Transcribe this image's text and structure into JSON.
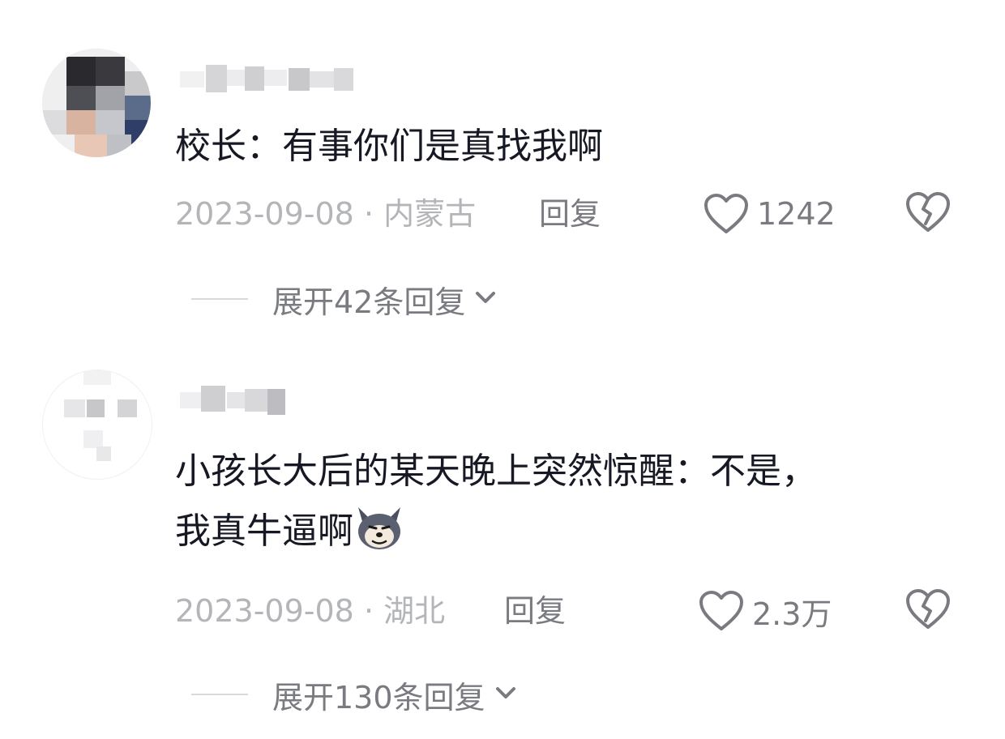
{
  "comments": [
    {
      "text": "校长：有事你们是真找我啊",
      "date": "2023-09-08",
      "separator": "·",
      "location": "内蒙古",
      "reply_label": "回复",
      "likes": "1242",
      "expand_label": "展开42条回复",
      "avatar_icon": "pixelated-avatar",
      "like_icon": "heart-outline-icon",
      "dislike_icon": "broken-heart-icon"
    },
    {
      "text_line1": "小孩长大后的某天晚上突然惊醒：不是，",
      "text_line2": "我真牛逼啊",
      "emoji_icon": "wolf-emoji-icon",
      "date": "2023-09-08",
      "separator": "·",
      "location": "湖北",
      "reply_label": "回复",
      "likes": "2.3万",
      "expand_label": "展开130条回复",
      "avatar_icon": "pixelated-avatar",
      "like_icon": "heart-outline-icon",
      "dislike_icon": "broken-heart-icon"
    }
  ],
  "colors": {
    "text_primary": "#161823",
    "text_meta": "#b4b5b8",
    "text_action": "#7a7b80"
  }
}
